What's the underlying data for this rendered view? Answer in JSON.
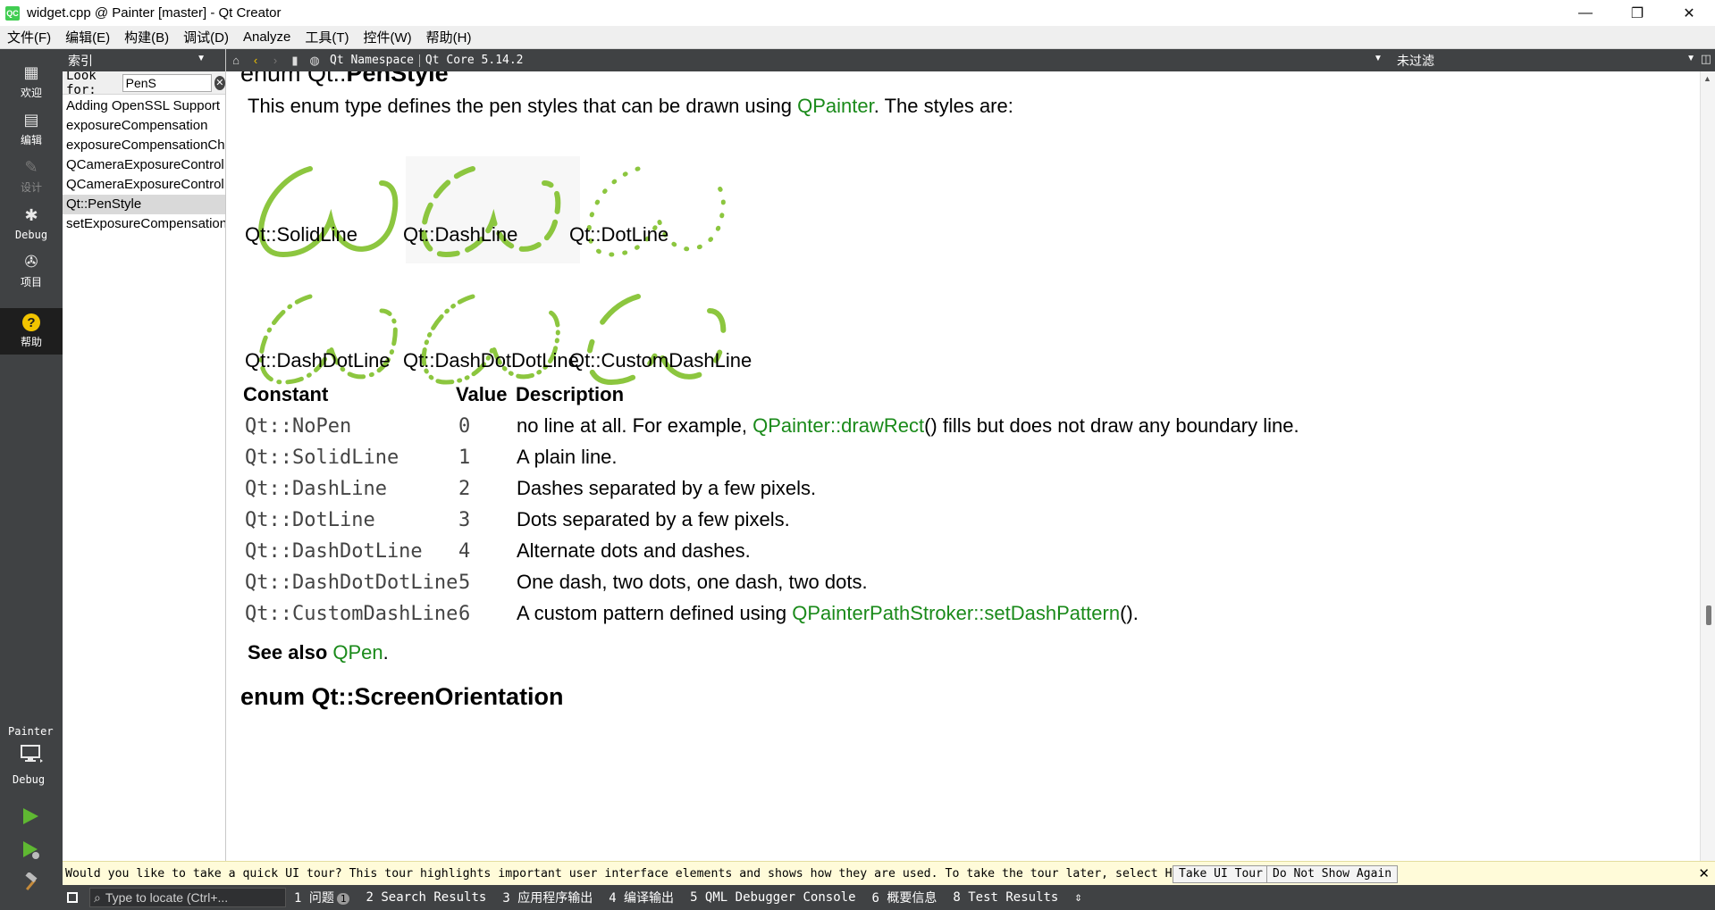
{
  "window": {
    "title": "widget.cpp @ Painter [master] - Qt Creator",
    "app_icon": "QC",
    "min_icon": "—",
    "max_icon": "❐",
    "close_icon": "✕"
  },
  "menu": [
    "文件(F)",
    "编辑(E)",
    "构建(B)",
    "调试(D)",
    "Analyze",
    "工具(T)",
    "控件(W)",
    "帮助(H)"
  ],
  "modes": [
    {
      "label": "欢迎",
      "icon": "grid-icon",
      "glyph": "▦",
      "state": "normal"
    },
    {
      "label": "编辑",
      "icon": "document-icon",
      "glyph": "▤",
      "state": "normal"
    },
    {
      "label": "设计",
      "icon": "pencil-icon",
      "glyph": "✎",
      "state": "disabled"
    },
    {
      "label": "Debug",
      "icon": "bug-icon",
      "glyph": "✱",
      "state": "normal"
    },
    {
      "label": "项目",
      "icon": "wrench-icon",
      "glyph": "✇",
      "state": "normal"
    },
    {
      "label": "帮助",
      "icon": "help-icon",
      "glyph": "?",
      "state": "active"
    }
  ],
  "target": {
    "project": "Painter",
    "config": "Debug"
  },
  "sidebar": {
    "header": "索引",
    "look_for_label": "Look for:",
    "look_for_value": "PenS",
    "items": [
      {
        "text": "Adding OpenSSL Support"
      },
      {
        "text": "exposureCompensation"
      },
      {
        "text": "exposureCompensationChanged"
      },
      {
        "text": "QCameraExposureControl"
      },
      {
        "text": "QCameraExposureControl::"
      },
      {
        "text": "Qt::PenStyle",
        "selected": true
      },
      {
        "text": "setExposureCompensation"
      }
    ]
  },
  "helptoolbar": {
    "crumb1": "Qt Namespace",
    "crumb2": "Qt Core 5.14.2",
    "filter": "未过滤"
  },
  "doc": {
    "heading1_prefix": "enum Qt::",
    "heading1_name": "PenStyle",
    "intro_before": "This enum type defines the pen styles that can be drawn using ",
    "intro_link": "QPainter",
    "intro_after": ". The styles are:",
    "captions": [
      "Qt::SolidLine",
      "Qt::DashLine",
      "Qt::DotLine",
      "Qt::DashDotLine",
      "Qt::DashDotDotLine",
      "Qt::CustomDashLine"
    ],
    "table_headers": {
      "constant": "Constant",
      "value": "Value",
      "description": "Description"
    },
    "rows": [
      {
        "name": "Qt::NoPen",
        "value": "0",
        "desc_before": "no line at all. For example, ",
        "link": "QPainter::drawRect",
        "desc_after": "() fills but does not draw any boundary line."
      },
      {
        "name": "Qt::SolidLine",
        "value": "1",
        "desc_before": "A plain line.",
        "link": "",
        "desc_after": ""
      },
      {
        "name": "Qt::DashLine",
        "value": "2",
        "desc_before": "Dashes separated by a few pixels.",
        "link": "",
        "desc_after": ""
      },
      {
        "name": "Qt::DotLine",
        "value": "3",
        "desc_before": "Dots separated by a few pixels.",
        "link": "",
        "desc_after": ""
      },
      {
        "name": "Qt::DashDotLine",
        "value": "4",
        "desc_before": "Alternate dots and dashes.",
        "link": "",
        "desc_after": ""
      },
      {
        "name": "Qt::DashDotDotLine",
        "value": "5",
        "desc_before": "One dash, two dots, one dash, two dots.",
        "link": "",
        "desc_after": ""
      },
      {
        "name": "Qt::CustomDashLine",
        "value": "6",
        "desc_before": "A custom pattern defined using ",
        "link": "QPainterPathStroker::setDashPattern",
        "desc_after": "()."
      }
    ],
    "see_also_label": "See also ",
    "see_also_link": "QPen",
    "see_also_after": ".",
    "heading2": "enum Qt::ScreenOrientation"
  },
  "tour": {
    "message": "Would you like to take a quick UI tour? This tour highlights important user interface elements and shows how they are used. To take the tour later, select Help > UI Tour.",
    "take_label": "Take UI Tour",
    "dont_label": "Do Not Show Again"
  },
  "status": {
    "locate_placeholder": "Type to locate (Ctrl+...",
    "panes": [
      {
        "label": "1 问题",
        "badge": "1"
      },
      {
        "label": "2 Search Results"
      },
      {
        "label": "3 应用程序输出"
      },
      {
        "label": "4 编译输出"
      },
      {
        "label": "5 QML Debugger Console"
      },
      {
        "label": "6 概要信息"
      },
      {
        "label": "8 Test Results"
      }
    ]
  },
  "colors": {
    "accent_green": "#8cc63f",
    "link_green": "#1a8a1a",
    "modebar": "#404244"
  }
}
